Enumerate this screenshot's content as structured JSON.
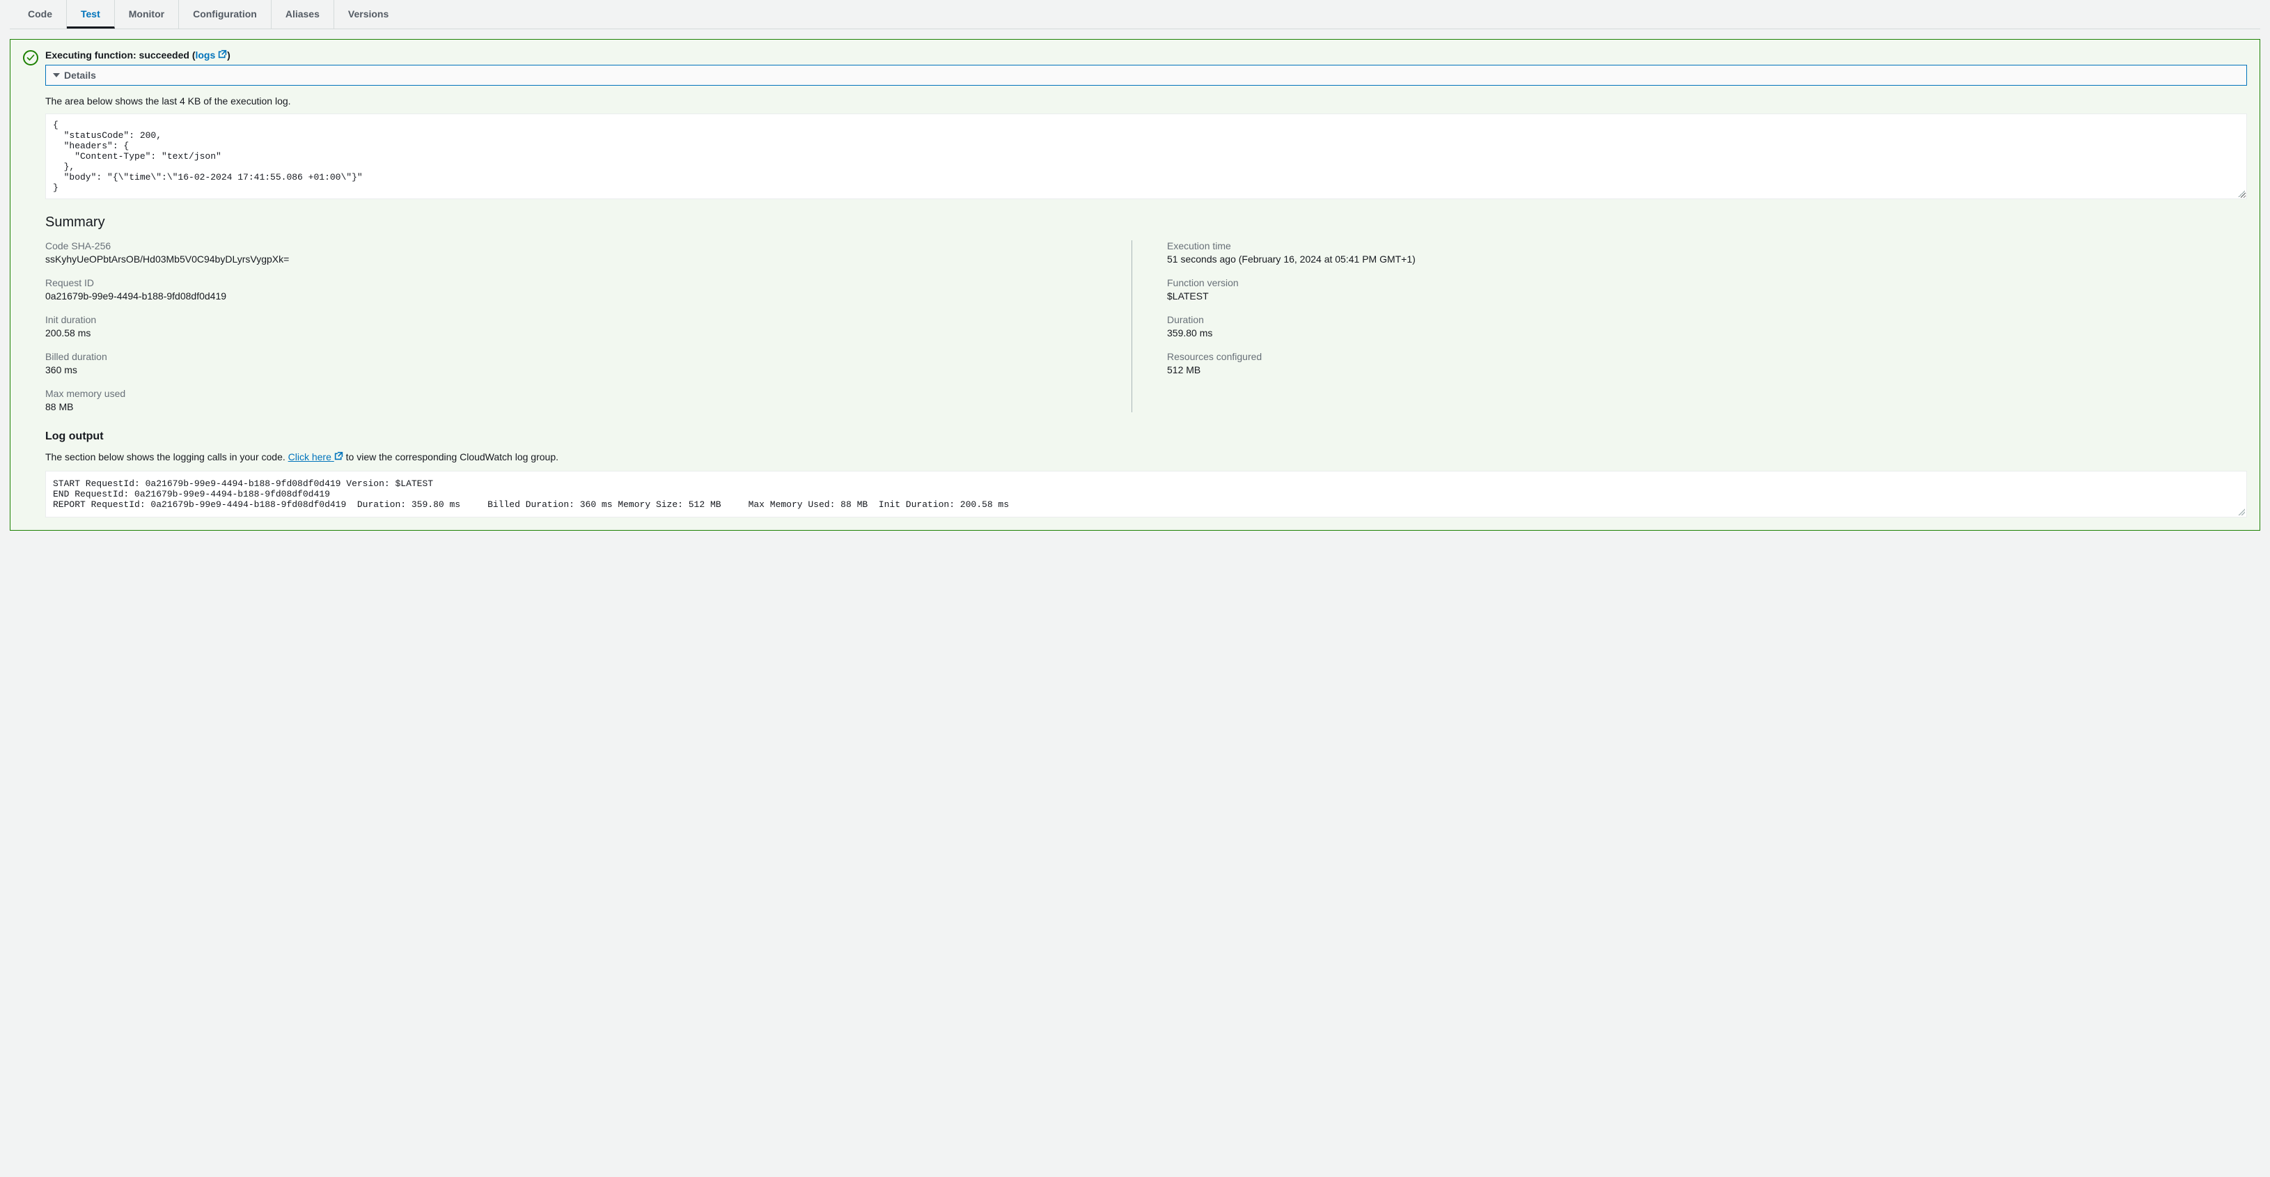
{
  "tabs": {
    "code": "Code",
    "test": "Test",
    "monitor": "Monitor",
    "configuration": "Configuration",
    "aliases": "Aliases",
    "versions": "Versions"
  },
  "result": {
    "title_prefix": "Executing function: succeeded (",
    "logs_link": "logs",
    "title_suffix": ")",
    "details_label": "Details",
    "note": "The area below shows the last 4 KB of the execution log.",
    "response_body": "{\n  \"statusCode\": 200,\n  \"headers\": {\n    \"Content-Type\": \"text/json\"\n  },\n  \"body\": \"{\\\"time\\\":\\\"16-02-2024 17:41:55.086 +01:00\\\"}\"\n}"
  },
  "summary": {
    "heading": "Summary",
    "left": {
      "code_sha256": {
        "label": "Code SHA-256",
        "value": "ssKyhyUeOPbtArsOB/Hd03Mb5V0C94byDLyrsVygpXk="
      },
      "request_id": {
        "label": "Request ID",
        "value": "0a21679b-99e9-4494-b188-9fd08df0d419"
      },
      "init_duration": {
        "label": "Init duration",
        "value": "200.58 ms"
      },
      "billed_duration": {
        "label": "Billed duration",
        "value": "360 ms"
      },
      "max_memory": {
        "label": "Max memory used",
        "value": "88 MB"
      }
    },
    "right": {
      "exec_time": {
        "label": "Execution time",
        "value": "51 seconds ago (February 16, 2024 at 05:41 PM GMT+1)"
      },
      "func_version": {
        "label": "Function version",
        "value": "$LATEST"
      },
      "duration": {
        "label": "Duration",
        "value": "359.80 ms"
      },
      "resources": {
        "label": "Resources configured",
        "value": "512 MB"
      }
    }
  },
  "log_output": {
    "heading": "Log output",
    "note_prefix": "The section below shows the logging calls in your code. ",
    "click_here": "Click here",
    "note_suffix": " to view the corresponding CloudWatch log group.",
    "content": "START RequestId: 0a21679b-99e9-4494-b188-9fd08df0d419 Version: $LATEST\nEND RequestId: 0a21679b-99e9-4494-b188-9fd08df0d419\nREPORT RequestId: 0a21679b-99e9-4494-b188-9fd08df0d419  Duration: 359.80 ms     Billed Duration: 360 ms Memory Size: 512 MB     Max Memory Used: 88 MB  Init Duration: 200.58 ms"
  }
}
